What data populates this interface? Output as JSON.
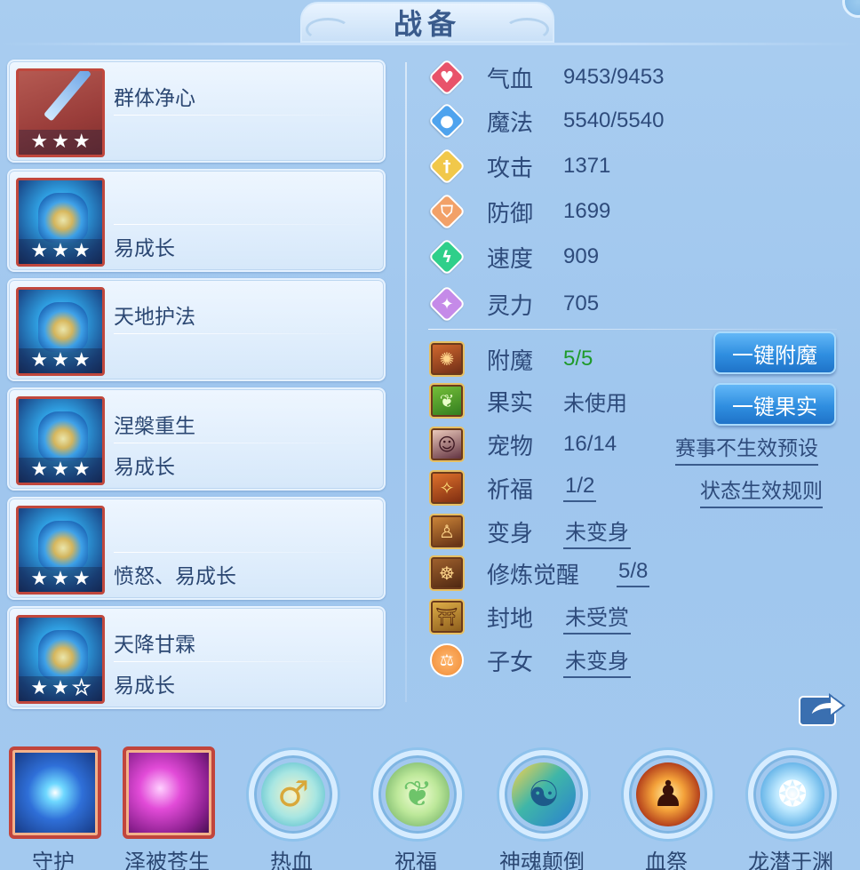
{
  "title": "战备",
  "cards": [
    {
      "name": "群体净心",
      "trait": "",
      "stars_filled": 3,
      "stars_total": 3
    },
    {
      "name": "",
      "trait": "易成长",
      "stars_filled": 3,
      "stars_total": 3
    },
    {
      "name": "天地护法",
      "trait": "",
      "stars_filled": 3,
      "stars_total": 3
    },
    {
      "name": "涅槃重生",
      "trait": "易成长",
      "stars_filled": 3,
      "stars_total": 3
    },
    {
      "name": "",
      "trait": "愤怒、易成长",
      "stars_filled": 3,
      "stars_total": 3
    },
    {
      "name": "天降甘霖",
      "trait": "易成长",
      "stars_filled": 2,
      "stars_total": 3
    }
  ],
  "stats": [
    {
      "label": "气血",
      "value": "9453/9453",
      "icon": "heart-icon",
      "color": "#e8536a"
    },
    {
      "label": "魔法",
      "value": "5540/5540",
      "icon": "mana-icon",
      "color": "#4ea3ee"
    },
    {
      "label": "攻击",
      "value": "1371",
      "icon": "sword-icon",
      "color": "#f1c84a"
    },
    {
      "label": "防御",
      "value": "1699",
      "icon": "shield-icon",
      "color": "#f2a168"
    },
    {
      "label": "速度",
      "value": "909",
      "icon": "lightning-icon",
      "color": "#2fcf8a"
    },
    {
      "label": "灵力",
      "value": "705",
      "icon": "spirit-icon",
      "color": "#c58ae8"
    }
  ],
  "extras": {
    "enchant": {
      "label": "附魔",
      "value": "5/5",
      "icon": "enchant-icon"
    },
    "fruit": {
      "label": "果实",
      "value": "未使用",
      "icon": "fruit-icon"
    },
    "pet": {
      "label": "宠物",
      "value": "16/14",
      "icon": "pet-portrait-icon"
    },
    "blessing": {
      "label": "祈福",
      "value": "1/2",
      "icon": "blessing-icon"
    },
    "transform": {
      "label": "变身",
      "value": "未变身",
      "icon": "transform-icon"
    },
    "cultivation": {
      "label": "修炼觉醒",
      "value": "5/8",
      "icon": "meditation-icon"
    },
    "fief": {
      "label": "封地",
      "value": "未受赏",
      "icon": "gate-icon"
    },
    "children": {
      "label": "子女",
      "value": "未变身",
      "icon": "children-icon"
    }
  },
  "buttons": {
    "one_click_enchant": "一键附魔",
    "one_click_fruit": "一键果实"
  },
  "links": {
    "event_preset": "赛事不生效预设",
    "status_rules": "状态生效规则"
  },
  "skills": [
    {
      "label": "守护",
      "icon": "guard-star-icon",
      "style": "square"
    },
    {
      "label": "泽被苍生",
      "icon": "palm-orb-icon",
      "style": "square"
    },
    {
      "label": "热血",
      "icon": "hot-blood-icon",
      "style": "circle"
    },
    {
      "label": "祝福",
      "icon": "blessing-leaf-icon",
      "style": "circle"
    },
    {
      "label": "神魂颠倒",
      "icon": "soul-icon",
      "style": "circle"
    },
    {
      "label": "血祭",
      "icon": "blood-sacrifice-icon",
      "style": "circle"
    },
    {
      "label": "龙潜于渊",
      "icon": "dragon-icon",
      "style": "circle"
    }
  ]
}
